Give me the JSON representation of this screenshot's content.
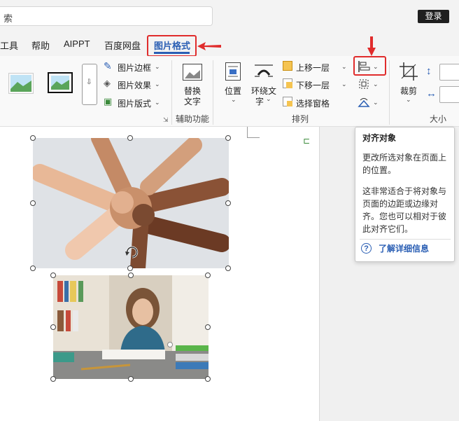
{
  "titlebar": {
    "search_text": "索",
    "login_label": "登录"
  },
  "tabs": [
    {
      "label": "工具"
    },
    {
      "label": "帮助"
    },
    {
      "label": "AIPPT"
    },
    {
      "label": "百度网盘"
    },
    {
      "label": "图片格式",
      "active": true
    }
  ],
  "ribbon": {
    "picture_border": "图片边框",
    "picture_effects": "图片效果",
    "picture_layout": "图片版式",
    "alt_text_line1": "替换",
    "alt_text_line2": "文字",
    "accessibility_group": "辅助功能",
    "position": "位置",
    "wrap_text_line1": "环绕文",
    "wrap_text_line2": "字",
    "bring_forward": "上移一层",
    "send_backward": "下移一层",
    "selection_pane": "选择窗格",
    "arrange_group": "排列",
    "crop": "裁剪",
    "size_group": "大小"
  },
  "tooltip": {
    "title": "对齐对象",
    "para1_line1": "更改所选对象在页面上",
    "para1_line2": "的位置。",
    "para2_line1": "这非常适合于将对象与",
    "para2_line2": "页面的边距或边缘对",
    "para2_line3": "齐。您也可以相对于彼",
    "para2_line4": "此对齐它们。",
    "learn_more": "了解详细信息"
  },
  "colors": {
    "accent_blue": "#2b5fb4",
    "annotation_red": "#e02c2c"
  }
}
